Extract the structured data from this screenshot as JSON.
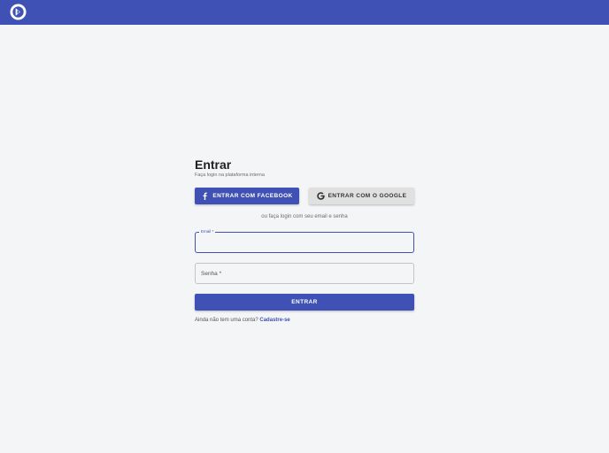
{
  "header": {
    "logo_icon": "app-logo-icon",
    "background_color": "#3f51b5"
  },
  "login": {
    "title": "Entrar",
    "subtitle": "Faça login na plataforma interna",
    "facebook_button": "ENTRAR COM FACEBOOK",
    "google_button": "ENTRAR COM O GOOGLE",
    "divider_text": "ou faça login com seu email e senha",
    "email_label": "Email *",
    "email_value": "",
    "password_label": "Senha *",
    "password_value": "",
    "submit_button": "ENTRAR",
    "signup_prompt": "Ainda não tem uma conta?",
    "signup_link": "Cadastre-se"
  },
  "colors": {
    "primary": "#3f51b5",
    "background": "#f4f5f7",
    "google_button_bg": "#e0e0e0"
  }
}
